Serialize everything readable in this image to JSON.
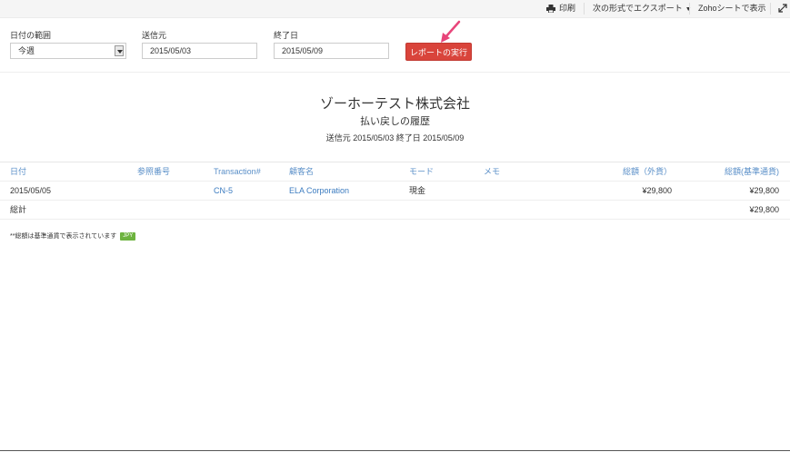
{
  "toolbar": {
    "print_label": "印刷",
    "export_label": "次の形式でエクスポート",
    "zoho_sheet_label": "Zohoシートで表示"
  },
  "filters": {
    "date_range_label": "日付の範囲",
    "date_range_value": "今週",
    "from_label": "送信元",
    "from_value": "2015/05/03",
    "to_label": "終了日",
    "to_value": "2015/05/09",
    "run_button_label": "レポートの実行"
  },
  "report": {
    "company": "ゾーホーテスト株式会社",
    "title": "払い戻しの履歴",
    "period": "送信元 2015/05/03 終了日 2015/05/09"
  },
  "table": {
    "headers": {
      "date": "日付",
      "reference": "参照番号",
      "transaction": "Transaction#",
      "customer": "顧客名",
      "mode": "モード",
      "memo": "メモ",
      "amount_fcy": "総額（外貨）",
      "amount_bcy": "総額(基準通貨)"
    },
    "rows": [
      {
        "date": "2015/05/05",
        "reference": "",
        "transaction": "CN-5",
        "customer": "ELA Corporation",
        "mode": "現金",
        "memo": "",
        "amount_fcy": "¥29,800",
        "amount_bcy": "¥29,800"
      }
    ],
    "total": {
      "label": "総計",
      "amount_bcy": "¥29,800"
    }
  },
  "footnote": {
    "text": "**総額は基準通貨で表示されています",
    "currency_badge": "JPY"
  },
  "colors": {
    "accent_button": "#d9443b",
    "link": "#3c7cc0",
    "header_text": "#5a8fc8",
    "badge": "#6db33f"
  }
}
